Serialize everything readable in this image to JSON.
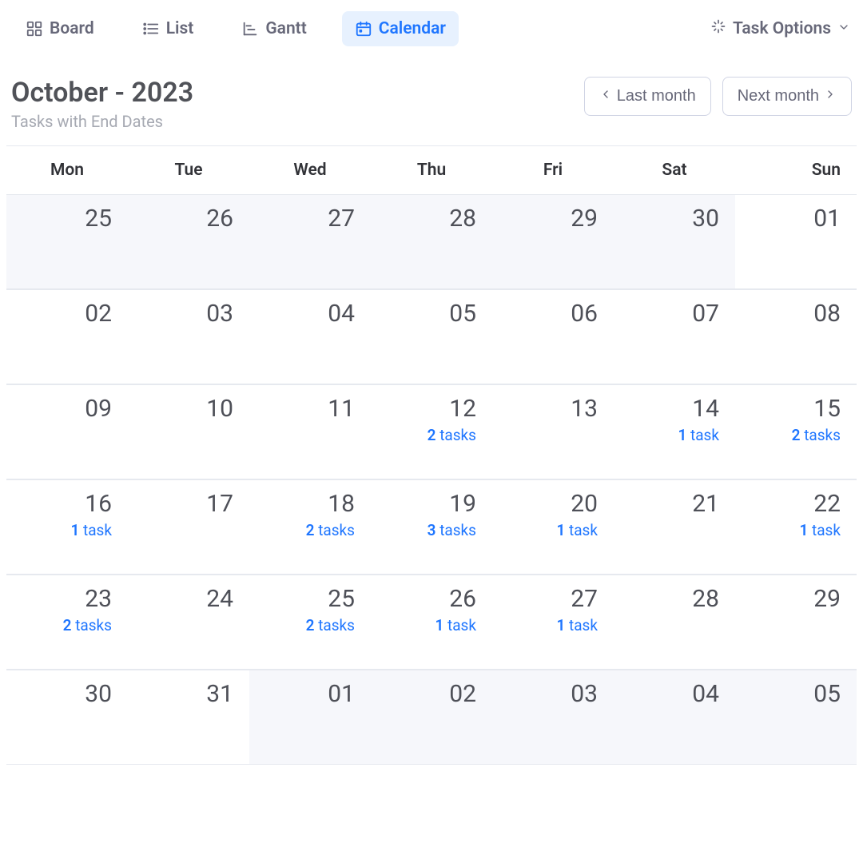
{
  "tabs": {
    "board": "Board",
    "list": "List",
    "gantt": "Gantt",
    "calendar": "Calendar",
    "task_options": "Task Options"
  },
  "header": {
    "title": "October - 2023",
    "subtitle": "Tasks with End Dates",
    "prev": "Last month",
    "next": "Next month"
  },
  "weekdays": [
    "Mon",
    "Tue",
    "Wed",
    "Thu",
    "Fri",
    "Sat",
    "Sun"
  ],
  "tasks_word_singular": "task",
  "tasks_word_plural": "tasks",
  "weeks": [
    [
      {
        "d": "25",
        "outside": true
      },
      {
        "d": "26",
        "outside": true
      },
      {
        "d": "27",
        "outside": true
      },
      {
        "d": "28",
        "outside": true
      },
      {
        "d": "29",
        "outside": true
      },
      {
        "d": "30",
        "outside": true
      },
      {
        "d": "01"
      }
    ],
    [
      {
        "d": "02"
      },
      {
        "d": "03"
      },
      {
        "d": "04"
      },
      {
        "d": "05"
      },
      {
        "d": "06"
      },
      {
        "d": "07"
      },
      {
        "d": "08"
      }
    ],
    [
      {
        "d": "09"
      },
      {
        "d": "10"
      },
      {
        "d": "11"
      },
      {
        "d": "12",
        "tasks": 2
      },
      {
        "d": "13"
      },
      {
        "d": "14",
        "tasks": 1
      },
      {
        "d": "15",
        "tasks": 2
      }
    ],
    [
      {
        "d": "16",
        "tasks": 1
      },
      {
        "d": "17"
      },
      {
        "d": "18",
        "tasks": 2
      },
      {
        "d": "19",
        "tasks": 3
      },
      {
        "d": "20",
        "tasks": 1
      },
      {
        "d": "21"
      },
      {
        "d": "22",
        "tasks": 1
      }
    ],
    [
      {
        "d": "23",
        "tasks": 2
      },
      {
        "d": "24"
      },
      {
        "d": "25",
        "tasks": 2
      },
      {
        "d": "26",
        "tasks": 1
      },
      {
        "d": "27",
        "tasks": 1
      },
      {
        "d": "28"
      },
      {
        "d": "29"
      }
    ],
    [
      {
        "d": "30"
      },
      {
        "d": "31"
      },
      {
        "d": "01",
        "outside": true
      },
      {
        "d": "02",
        "outside": true
      },
      {
        "d": "03",
        "outside": true
      },
      {
        "d": "04",
        "outside": true
      },
      {
        "d": "05",
        "outside": true
      }
    ]
  ]
}
